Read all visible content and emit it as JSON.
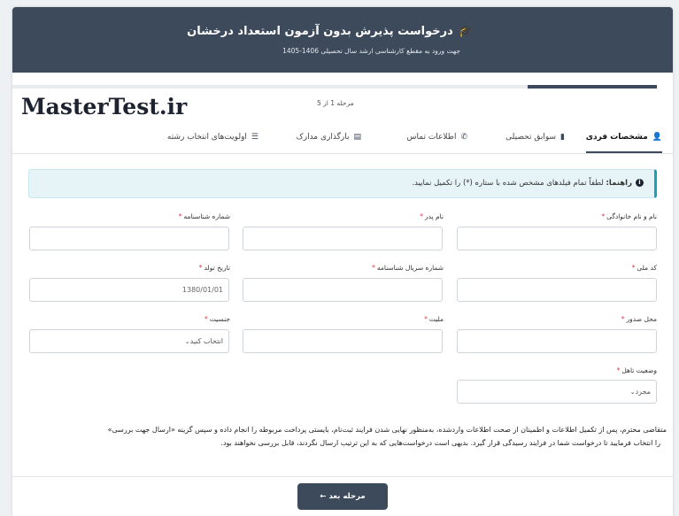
{
  "header": {
    "title_icon": "graduation-cap-icon",
    "title": "درخواست پذیرش بدون آزمون استعداد درخشان",
    "subtitle": "جهت ورود به مقطع کارشناسی ارشد سال تحصیلی 1406-1405"
  },
  "progress": {
    "fraction": 0.2
  },
  "logo": "MasterTest.ir",
  "step_counter": "مرحله 1 از 5",
  "tabs": [
    {
      "label": "مشخصات فردی",
      "icon": "user-icon",
      "active": true
    },
    {
      "label": "سوابق تحصیلی",
      "icon": "book-icon"
    },
    {
      "label": "اطلاعات تماس",
      "icon": "phone-icon"
    },
    {
      "label": "بارگذاری مدارک",
      "icon": "file-icon"
    },
    {
      "label": "اولویت‌های انتخاب رشته",
      "icon": "list-icon"
    }
  ],
  "alert": {
    "icon": "info-icon",
    "title": "راهنما:",
    "text": "لطفاً تمام فیلدهای مشخص شده با ستاره (*) را تکمیل نمایید."
  },
  "fields": {
    "fullname": {
      "label": "نام و نام خانوادگی",
      "value": ""
    },
    "father": {
      "label": "نام پدر",
      "value": ""
    },
    "idnum": {
      "label": "شماره شناسنامه",
      "value": ""
    },
    "national": {
      "label": "کد ملی",
      "value": ""
    },
    "serial": {
      "label": "شماره سریال شناسنامه",
      "value": ""
    },
    "birth": {
      "label": "تاریخ تولد",
      "placeholder": "1380/01/01"
    },
    "issue": {
      "label": "محل صدور",
      "value": ""
    },
    "nationality": {
      "label": "ملیت",
      "value": ""
    },
    "gender": {
      "label": "جنسیت",
      "value": "انتخاب کنید"
    },
    "marital": {
      "label": "وضعیت تاهل",
      "value": "مجرد"
    }
  },
  "required_mark": "*",
  "note": {
    "line1": "متقاضی محترم، پس از تکمیل اطلاعات و اطمینان از صحت اطلاعات واردشده، به‌منظور نهایی شدن فرایند ثبت‌نام، بایستی پرداخت مربوطه را انجام داده و سپس گزینه «ارسال جهت بررسی»",
    "line2": "را انتخاب فرمایید تا درخواست شما در فرایند رسیدگی قرار گیرد. بدیهی است درخواست‌هایی که به این ترتیب ارسال نگردند، قابل بررسی نخواهند بود."
  },
  "next_button": "مرحله بعد ←"
}
